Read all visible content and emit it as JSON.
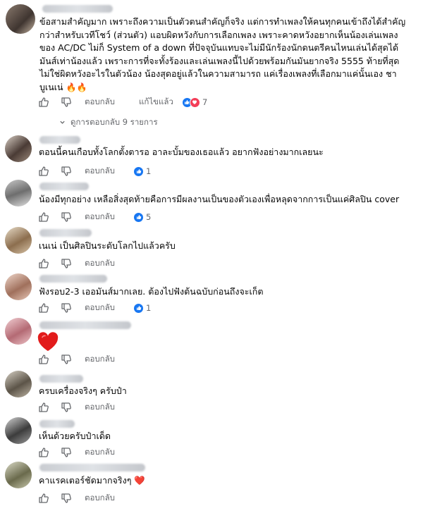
{
  "main_comment": {
    "text": "ข้อสามสำคัญมาก เพราะถึงความเป็นตัวตนสำคัญก็จริง แต่การทำเพลงให้คนทุกคนเข้าถึงได้สำคัญกว่าสำหรับเวทีโชว์ (ส่วนตัว) แอบผิดหวังกับการเลือกเพลง เพราะคาดหวังอยากเห็นน้องเล่นเพลงของ AC/DC ไม่ก็ System of a down ที่ปัจจุบันแทบจะไม่มีนักร้องนักดนตรีคนไหนเล่นได้สุดได้มันส์เท่าน้องแล้ว เพราะการที่จะทั้งร้องและเล่นเพลงนี้ไปด้วยพร้อมกันมันยากจริง 5555 ท้ายที่สุดไม่ใช่ผิดหวังอะไรในตัวน้อง น้องสุดอยู่แล้วในความสามารถ แค่เรื่องเพลงที่เลือกมาแค่นั้นเอง ชาบูเนเน่",
    "emoji": "🔥🔥",
    "reply_label": "ตอบกลับ",
    "edited_label": "แก้ไขแล้ว",
    "reaction_count": "7"
  },
  "replies_toggle": "ดูการตอบกลับ 9 รายการ",
  "replies": [
    {
      "text": "ตอนนี้คนเกือบทั้งโลกตั้งตารอ อาละบั้มของเธอแล้ว อยากฟังอย่างมากเลยนะ",
      "reply_label": "ตอบกลับ",
      "reaction_count": "1"
    },
    {
      "text": "น้องมีทุกอย่าง เหลือสิ่งสุดท้ายคือการมีผลงานเป็นของตัวเองเพื่อหลุดจากการเป็นแค่ศิลปิน cover",
      "reply_label": "ตอบกลับ",
      "reaction_count": "5"
    },
    {
      "text": "เนเน่ เป็นศิลปินระดับโลกไปแล้วครับ",
      "reply_label": "ตอบกลับ",
      "reaction_count": ""
    },
    {
      "text": "ฟังรอบ2-3 เออมันส์มากเลย. ต้องไปฟังต้นฉบับก่อนถึงจะเก็ต",
      "reply_label": "ตอบกลับ",
      "reaction_count": "1"
    },
    {
      "text": "",
      "emoji": "❤️",
      "reply_label": "ตอบกลับ",
      "reaction_count": ""
    },
    {
      "text": "ครบเครื่องจริงๆ ครับป๋า",
      "reply_label": "ตอบกลับ",
      "reaction_count": ""
    },
    {
      "text": "เห็นด้วยครับป๋าเด็ด",
      "reply_label": "ตอบกลับ",
      "reaction_count": ""
    },
    {
      "text": "คาแรคเตอร์ชัดมากจริงๆ",
      "emoji": "❤️",
      "reply_label": "ตอบกลับ",
      "reaction_count": ""
    }
  ],
  "colors": {
    "like": "#1877f2",
    "love": "#f33e58",
    "muted": "#65676b"
  }
}
